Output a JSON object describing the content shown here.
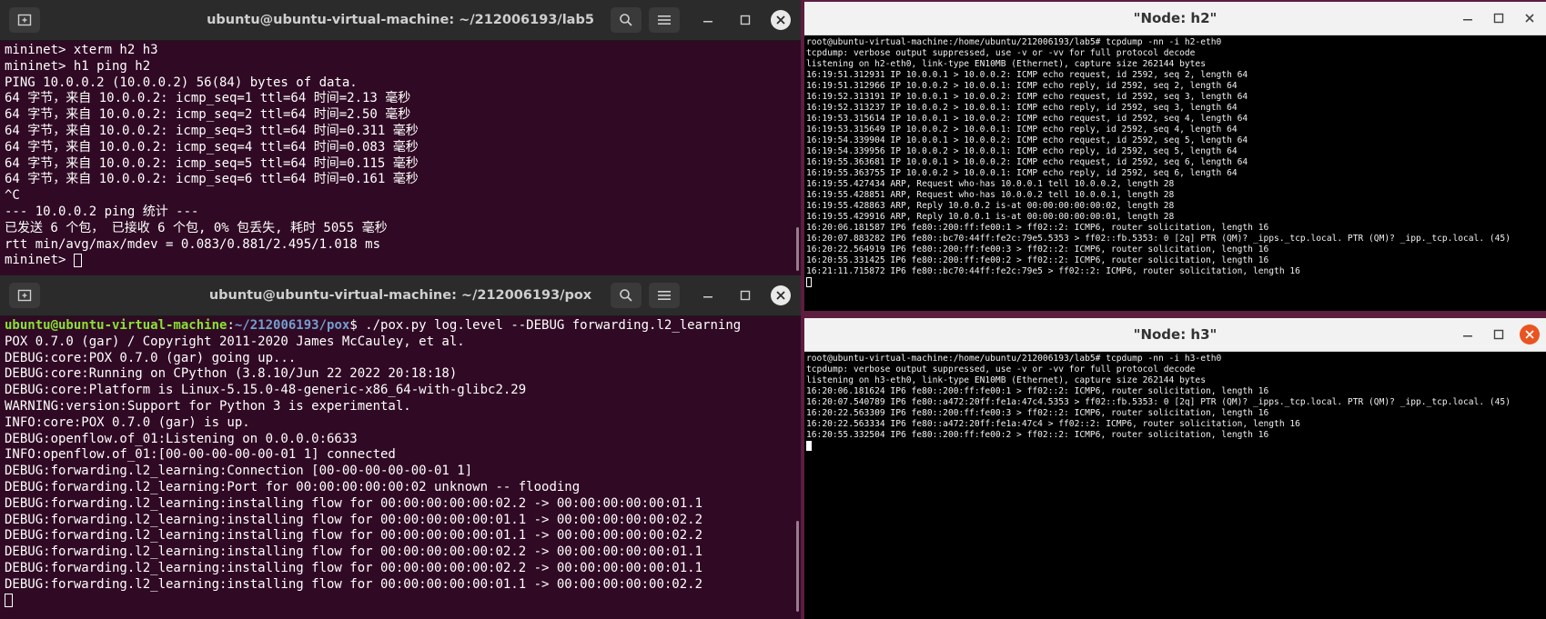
{
  "terminal_top": {
    "title": "ubuntu@ubuntu-virtual-machine: ~/212006193/lab5",
    "lines": [
      "mininet> xterm h2 h3",
      "mininet> h1 ping h2",
      "PING 10.0.0.2 (10.0.0.2) 56(84) bytes of data.",
      "64 字节，来自 10.0.0.2: icmp_seq=1 ttl=64 时间=2.13 毫秒",
      "64 字节，来自 10.0.0.2: icmp_seq=2 ttl=64 时间=2.50 毫秒",
      "64 字节，来自 10.0.0.2: icmp_seq=3 ttl=64 时间=0.311 毫秒",
      "64 字节，来自 10.0.0.2: icmp_seq=4 ttl=64 时间=0.083 毫秒",
      "64 字节，来自 10.0.0.2: icmp_seq=5 ttl=64 时间=0.115 毫秒",
      "64 字节，来自 10.0.0.2: icmp_seq=6 ttl=64 时间=0.161 毫秒",
      "^C",
      "--- 10.0.0.2 ping 统计 ---",
      "已发送 6 个包， 已接收 6 个包, 0% 包丢失, 耗时 5055 毫秒",
      "rtt min/avg/max/mdev = 0.083/0.881/2.495/1.018 ms"
    ],
    "prompt": "mininet> "
  },
  "terminal_bottom": {
    "title": "ubuntu@ubuntu-virtual-machine: ~/212006193/pox",
    "prompt_user": "ubuntu@ubuntu-virtual-machine",
    "prompt_sep": ":",
    "prompt_path": "~/212006193/pox",
    "prompt_cmd": "$ ./pox.py log.level --DEBUG forwarding.l2_learning",
    "lines": [
      "POX 0.7.0 (gar) / Copyright 2011-2020 James McCauley, et al.",
      "DEBUG:core:POX 0.7.0 (gar) going up...",
      "DEBUG:core:Running on CPython (3.8.10/Jun 22 2022 20:18:18)",
      "DEBUG:core:Platform is Linux-5.15.0-48-generic-x86_64-with-glibc2.29",
      "WARNING:version:Support for Python 3 is experimental.",
      "INFO:core:POX 0.7.0 (gar) is up.",
      "DEBUG:openflow.of_01:Listening on 0.0.0.0:6633",
      "INFO:openflow.of_01:[00-00-00-00-00-01 1] connected",
      "DEBUG:forwarding.l2_learning:Connection [00-00-00-00-00-01 1]",
      "DEBUG:forwarding.l2_learning:Port for 00:00:00:00:00:02 unknown -- flooding",
      "DEBUG:forwarding.l2_learning:installing flow for 00:00:00:00:00:02.2 -> 00:00:00:00:00:01.1",
      "DEBUG:forwarding.l2_learning:installing flow for 00:00:00:00:00:01.1 -> 00:00:00:00:00:02.2",
      "DEBUG:forwarding.l2_learning:installing flow for 00:00:00:00:00:01.1 -> 00:00:00:00:00:02.2",
      "DEBUG:forwarding.l2_learning:installing flow for 00:00:00:00:00:02.2 -> 00:00:00:00:00:01.1",
      "DEBUG:forwarding.l2_learning:installing flow for 00:00:00:00:00:02.2 -> 00:00:00:00:00:01.1",
      "DEBUG:forwarding.l2_learning:installing flow for 00:00:00:00:00:01.1 -> 00:00:00:00:00:02.2"
    ]
  },
  "node_h2": {
    "title": "\"Node: h2\"",
    "lines": [
      "root@ubuntu-virtual-machine:/home/ubuntu/212006193/lab5# tcpdump -nn -i h2-eth0",
      "tcpdump: verbose output suppressed, use -v or -vv for full protocol decode",
      "listening on h2-eth0, link-type EN10MB (Ethernet), capture size 262144 bytes",
      "16:19:51.312931 IP 10.0.0.1 > 10.0.0.2: ICMP echo request, id 2592, seq 2, length 64",
      "16:19:51.312966 IP 10.0.0.2 > 10.0.0.1: ICMP echo reply, id 2592, seq 2, length 64",
      "16:19:52.313191 IP 10.0.0.1 > 10.0.0.2: ICMP echo request, id 2592, seq 3, length 64",
      "16:19:52.313237 IP 10.0.0.2 > 10.0.0.1: ICMP echo reply, id 2592, seq 3, length 64",
      "16:19:53.315614 IP 10.0.0.1 > 10.0.0.2: ICMP echo request, id 2592, seq 4, length 64",
      "16:19:53.315649 IP 10.0.0.2 > 10.0.0.1: ICMP echo reply, id 2592, seq 4, length 64",
      "16:19:54.339904 IP 10.0.0.1 > 10.0.0.2: ICMP echo request, id 2592, seq 5, length 64",
      "16:19:54.339956 IP 10.0.0.2 > 10.0.0.1: ICMP echo reply, id 2592, seq 5, length 64",
      "16:19:55.363681 IP 10.0.0.1 > 10.0.0.2: ICMP echo request, id 2592, seq 6, length 64",
      "16:19:55.363755 IP 10.0.0.2 > 10.0.0.1: ICMP echo reply, id 2592, seq 6, length 64",
      "16:19:55.427434 ARP, Request who-has 10.0.0.1 tell 10.0.0.2, length 28",
      "16:19:55.428851 ARP, Request who-has 10.0.0.2 tell 10.0.0.1, length 28",
      "16:19:55.428863 ARP, Reply 10.0.0.2 is-at 00:00:00:00:00:02, length 28",
      "16:19:55.429916 ARP, Reply 10.0.0.1 is-at 00:00:00:00:00:01, length 28",
      "16:20:06.181587 IP6 fe80::200:ff:fe00:1 > ff02::2: ICMP6, router solicitation, length 16",
      "16:20:07.883282 IP6 fe80::bc70:44ff:fe2c:79e5.5353 > ff02::fb.5353: 0 [2q] PTR (QM)? _ipps._tcp.local. PTR (QM)? _ipp._tcp.local. (45)",
      "16:20:22.564919 IP6 fe80::200:ff:fe00:3 > ff02::2: ICMP6, router solicitation, length 16",
      "16:20:55.331425 IP6 fe80::200:ff:fe00:2 > ff02::2: ICMP6, router solicitation, length 16",
      "16:21:11.715872 IP6 fe80::bc70:44ff:fe2c:79e5 > ff02::2: ICMP6, router solicitation, length 16"
    ]
  },
  "node_h3": {
    "title": "\"Node: h3\"",
    "lines": [
      "root@ubuntu-virtual-machine:/home/ubuntu/212006193/lab5# tcpdump -nn -i h3-eth0",
      "tcpdump: verbose output suppressed, use -v or -vv for full protocol decode",
      "listening on h3-eth0, link-type EN10MB (Ethernet), capture size 262144 bytes",
      "16:20:06.181624 IP6 fe80::200:ff:fe00:1 > ff02::2: ICMP6, router solicitation, length 16",
      "16:20:07.540789 IP6 fe80::a472:20ff:fe1a:47c4.5353 > ff02::fb.5353: 0 [2q] PTR (QM)? _ipps._tcp.local. PTR (QM)? _ipp._tcp.local. (45)",
      "16:20:22.563309 IP6 fe80::200:ff:fe00:3 > ff02::2: ICMP6, router solicitation, length 16",
      "16:20:22.563334 IP6 fe80::a472:20ff:fe1a:47c4 > ff02::2: ICMP6, router solicitation, length 16",
      "16:20:55.332504 IP6 fe80::200:ff:fe00:2 > ff02::2: ICMP6, router solicitation, length 16"
    ]
  },
  "colors": {
    "terminal_bg": "#300a24",
    "desktop_bg": "#5c1d3f",
    "xterm_bg": "#000000",
    "prompt_user": "#8ae234",
    "prompt_path": "#729fcf",
    "close_active": "#e95420"
  }
}
